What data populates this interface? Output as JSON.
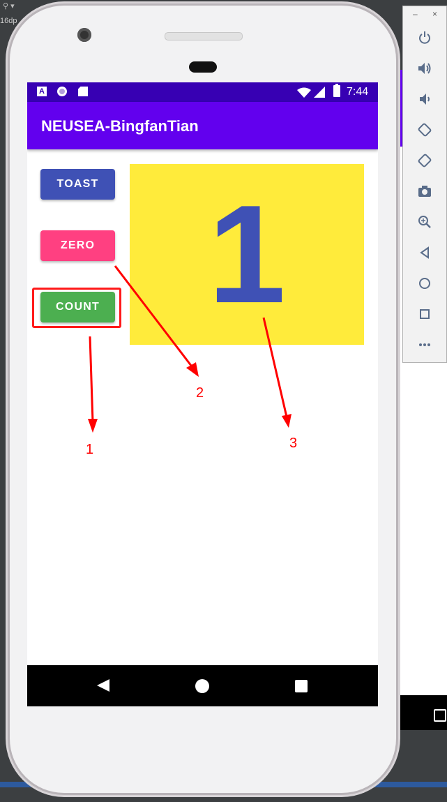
{
  "app": {
    "title": "NEUSEA-BingfanTian"
  },
  "status_bar": {
    "time": "7:44",
    "icons": [
      "a-notification-icon",
      "circle-notification-icon",
      "sd-card-icon",
      "wifi-icon",
      "signal-icon",
      "battery-icon"
    ]
  },
  "buttons": {
    "toast": "TOAST",
    "zero": "ZERO",
    "count": "COUNT"
  },
  "counter": {
    "value": "1"
  },
  "colors": {
    "status_bar": "#3700b3",
    "app_bar": "#6200ee",
    "toast_button": "#3f51b5",
    "zero_button": "#ff4081",
    "count_button": "#4caf50",
    "count_box": "#ffeb3b",
    "count_text": "#3f51b5",
    "annotation": "#ff0000"
  },
  "annotations": {
    "labels": [
      "1",
      "2",
      "3"
    ]
  },
  "emulator_toolbar": {
    "items": [
      "power-icon",
      "volume-up-icon",
      "volume-down-icon",
      "rotate-left-icon",
      "rotate-right-icon",
      "camera-icon",
      "zoom-icon",
      "back-icon",
      "home-icon",
      "overview-icon",
      "more-icon"
    ]
  }
}
